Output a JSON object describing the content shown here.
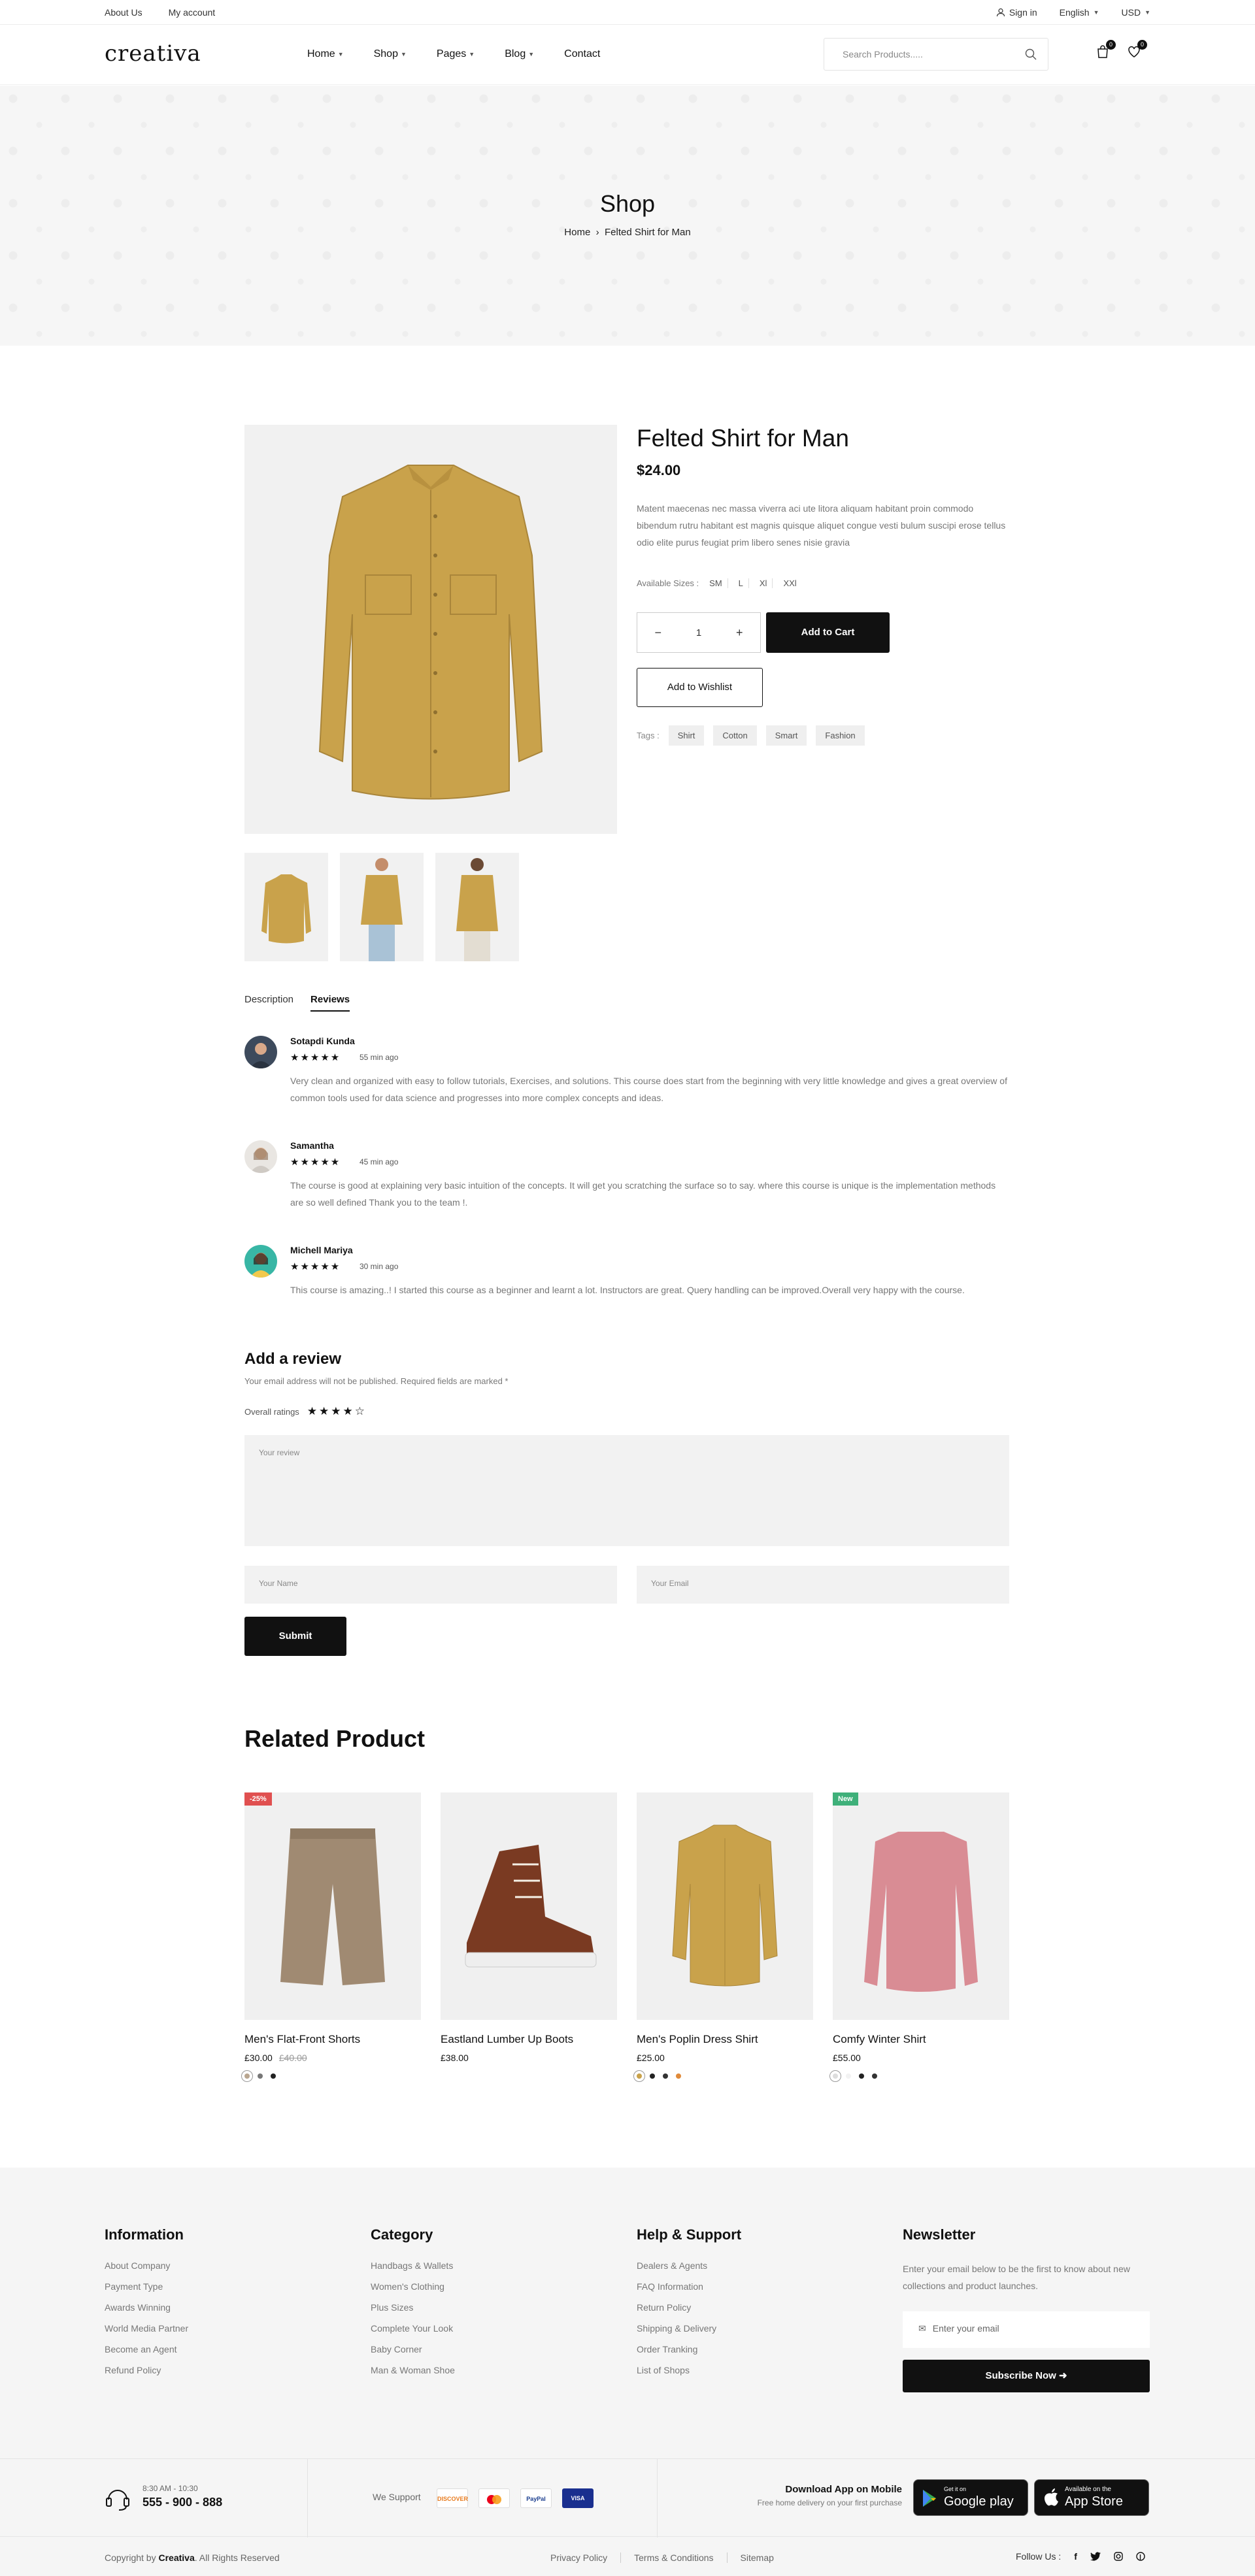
{
  "topbar": {
    "about": "About Us",
    "account": "My account",
    "signin": "Sign in",
    "language": "English",
    "currency": "USD"
  },
  "header": {
    "logo": "creativa",
    "nav": [
      "Home",
      "Shop",
      "Pages",
      "Blog",
      "Contact"
    ],
    "search_placeholder": "Search Products.....",
    "cart_count": "0",
    "wishlist_count": "0"
  },
  "banner": {
    "title": "Shop",
    "crumb_home": "Home",
    "crumb_sep": "›",
    "crumb_current": "Felted Shirt for Man"
  },
  "product": {
    "title": "Felted Shirt for Man",
    "price": "$24.00",
    "description": "Matent maecenas nec massa viverra aci ute litora aliquam habitant proin commodo bibendum rutru habitant est magnis quisque aliquet congue vesti bulum suscipi erose tellus odio elite purus feugiat prim libero senes nisie gravia",
    "sizes_label": "Available Sizes :",
    "sizes": [
      "SM",
      "L",
      "Xl",
      "XXl"
    ],
    "qty": "1",
    "minus": "−",
    "plus": "+",
    "add_to_cart": "Add to Cart",
    "add_to_wishlist": "Add to Wishlist",
    "tags_label": "Tags :",
    "tags": [
      "Shirt",
      "Cotton",
      "Smart",
      "Fashion"
    ]
  },
  "tabs": {
    "description": "Description",
    "reviews": "Reviews"
  },
  "reviews": [
    {
      "name": "Sotapdi Kunda",
      "stars": "★★★★★",
      "time": "55 min ago",
      "text": "Very clean and organized with easy to follow tutorials, Exercises, and solutions. This course does start from the beginning with very little knowledge and gives a great overview of common tools used for data science and progresses into more complex concepts and ideas."
    },
    {
      "name": "Samantha",
      "stars": "★★★★★",
      "time": "45 min ago",
      "text": "The course is good at explaining very basic intuition of the concepts. It will get you scratching the surface so to say. where this course is unique is the implementation methods are so well defined Thank you to the team !."
    },
    {
      "name": "Michell Mariya",
      "stars": "★★★★★",
      "time": "30 min ago",
      "text": "This course is amazing..! I started this course as a beginner and learnt a lot. Instructors are great. Query handling can be improved.Overall very happy with the course."
    }
  ],
  "add_review": {
    "title": "Add a review",
    "note": "Your email address will not be published. Required fields are marked *",
    "overall_label": "Overall ratings",
    "overall_stars": "★★★★☆",
    "review_placeholder": "Your review",
    "name_placeholder": "Your Name",
    "email_placeholder": "Your Email",
    "submit": "Submit"
  },
  "related": {
    "title": "Related Product",
    "items": [
      {
        "name": "Men's Flat-Front Shorts",
        "price": "£30.00",
        "old_price": "£40.00",
        "label": "-25%",
        "label_color": "#e05050"
      },
      {
        "name": "Eastland Lumber Up Boots",
        "price": "£38.00",
        "old_price": "",
        "label": "",
        "label_color": ""
      },
      {
        "name": "Men's Poplin Dress Shirt",
        "price": "£25.00",
        "old_price": "",
        "label": "",
        "label_color": ""
      },
      {
        "name": "Comfy Winter Shirt",
        "price": "£55.00",
        "old_price": "",
        "label": "New",
        "label_color": "#3fb07a"
      }
    ]
  },
  "footer": {
    "information": {
      "title": "Information",
      "links": [
        "About Company",
        "Payment Type",
        "Awards Winning",
        "World Media Partner",
        "Become an Agent",
        "Refund Policy"
      ]
    },
    "category": {
      "title": "Category",
      "links": [
        "Handbags & Wallets",
        "Women's Clothing",
        "Plus Sizes",
        "Complete Your Look",
        "Baby Corner",
        "Man & Woman Shoe"
      ]
    },
    "help": {
      "title": "Help & Support",
      "links": [
        "Dealers & Agents",
        "FAQ Information",
        "Return Policy",
        "Shipping & Delivery",
        "Order Tranking",
        "List of Shops"
      ]
    },
    "newsletter": {
      "title": "Newsletter",
      "text": "Enter your email below to be the first to know about new collections and product launches.",
      "placeholder": "Enter your email",
      "button": "Subscribe Now"
    },
    "support_hours": "8:30 AM - 10:30",
    "support_phone": "555 - 900 - 888",
    "we_support": "We Support",
    "payments": [
      "DISCOVER",
      "MC",
      "PayPal",
      "VISA"
    ],
    "app_title": "Download App on Mobile",
    "app_sub": "Free home delivery on your first purchase",
    "google_small": "Get it on",
    "google_big": "Google play",
    "apple_small": "Available on the",
    "apple_big": "App Store",
    "copyright_pre": "Copyright by",
    "copyright_brand": "Creativa",
    "copyright_post": ". All Rights Reserved",
    "bottom_links": [
      "Privacy Policy",
      "Terms & Conditions",
      "Sitemap"
    ],
    "follow": "Follow Us :"
  }
}
